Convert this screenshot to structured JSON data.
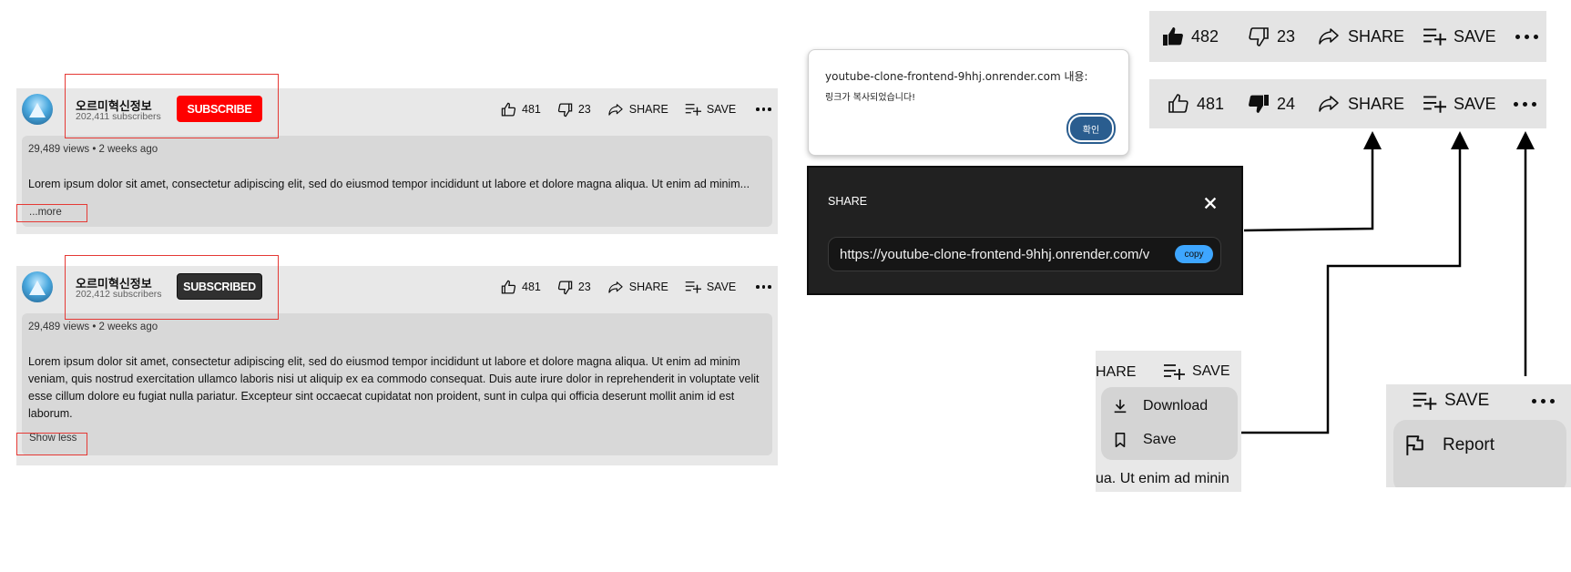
{
  "panel1": {
    "channel_name": "오르미혁신정보",
    "subscribers": "202,411 subscribers",
    "subscribe_label": "SUBSCRIBE",
    "likes": "481",
    "dislikes": "23",
    "share_label": "SHARE",
    "save_label": "SAVE",
    "meta": "29,489 views • 2 weeks ago",
    "description": "Lorem ipsum dolor sit amet, consectetur adipiscing elit, sed do eiusmod tempor incididunt ut labore et dolore magna aliqua. Ut enim ad minim...",
    "toggle": "...more"
  },
  "panel2": {
    "channel_name": "오르미혁신정보",
    "subscribers": "202,412 subscribers",
    "subscribe_label": "SUBSCRIBED",
    "likes": "481",
    "dislikes": "23",
    "share_label": "SHARE",
    "save_label": "SAVE",
    "meta": "29,489 views • 2 weeks ago",
    "description_lines": [
      "Lorem ipsum dolor sit amet, consectetur adipiscing elit, sed do eiusmod tempor incididunt ut labore et dolore magna aliqua. Ut enim ad minim",
      "veniam, quis nostrud exercitation ullamco laboris nisi ut aliquip ex ea commodo consequat. Duis aute irure dolor in reprehenderit in voluptate velit",
      "esse cillum dolore eu fugiat nulla pariatur. Excepteur sint occaecat cupidatat non proident, sunt in culpa qui officia deserunt mollit anim id est",
      "laborum."
    ],
    "toggle": "Show less"
  },
  "alert": {
    "title": "youtube-clone-frontend-9hhj.onrender.com 내용:",
    "message": "링크가 복사되었습니다!",
    "ok_label": "확인"
  },
  "share_dialog": {
    "title": "SHARE",
    "url": "https://youtube-clone-frontend-9hhj.onrender.com/v",
    "copy_label": "copy"
  },
  "zoom_bar1": {
    "likes": "482",
    "dislikes": "23",
    "share_label": "SHARE",
    "save_label": "SAVE"
  },
  "zoom_bar2": {
    "likes": "481",
    "dislikes": "24",
    "share_label": "SHARE",
    "save_label": "SAVE"
  },
  "download_popup": {
    "share_fragment": "HARE",
    "save_label": "SAVE",
    "items": [
      "Download",
      "Save"
    ],
    "footer_text": "ua. Ut enim ad minin"
  },
  "report_popup": {
    "save_label": "SAVE",
    "items": [
      "Report"
    ]
  },
  "colors": {
    "subscribe_red": "#ff0000",
    "subscribed_dark": "#303030",
    "highlight_red": "#e53935",
    "copy_blue": "#3ea6ff",
    "alert_button": "#2a5d8f"
  }
}
